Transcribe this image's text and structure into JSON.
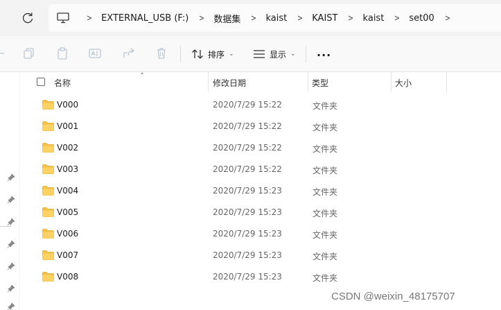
{
  "breadcrumb": {
    "items": [
      "EXTERNAL_USB (F:)",
      "数据集",
      "kaist",
      "KAIST",
      "kaist",
      "set00"
    ]
  },
  "toolbar": {
    "sort_label": "排序",
    "view_label": "显示",
    "more_label": "···"
  },
  "columns": {
    "name": "名称",
    "date": "修改日期",
    "type": "类型",
    "size": "大小"
  },
  "files": [
    {
      "name": "V000",
      "date": "2020/7/29 15:22",
      "type": "文件夹"
    },
    {
      "name": "V001",
      "date": "2020/7/29 15:22",
      "type": "文件夹"
    },
    {
      "name": "V002",
      "date": "2020/7/29 15:22",
      "type": "文件夹"
    },
    {
      "name": "V003",
      "date": "2020/7/29 15:22",
      "type": "文件夹"
    },
    {
      "name": "V004",
      "date": "2020/7/29 15:23",
      "type": "文件夹"
    },
    {
      "name": "V005",
      "date": "2020/7/29 15:23",
      "type": "文件夹"
    },
    {
      "name": "V006",
      "date": "2020/7/29 15:23",
      "type": "文件夹"
    },
    {
      "name": "V007",
      "date": "2020/7/29 15:23",
      "type": "文件夹"
    },
    {
      "name": "V008",
      "date": "2020/7/29 15:23",
      "type": "文件夹"
    }
  ],
  "watermark": "CSDN @weixin_48175707",
  "colors": {
    "folder": "#f6c24a",
    "folder_dark": "#e3a820",
    "icon_disabled": "#b9c7d6"
  }
}
